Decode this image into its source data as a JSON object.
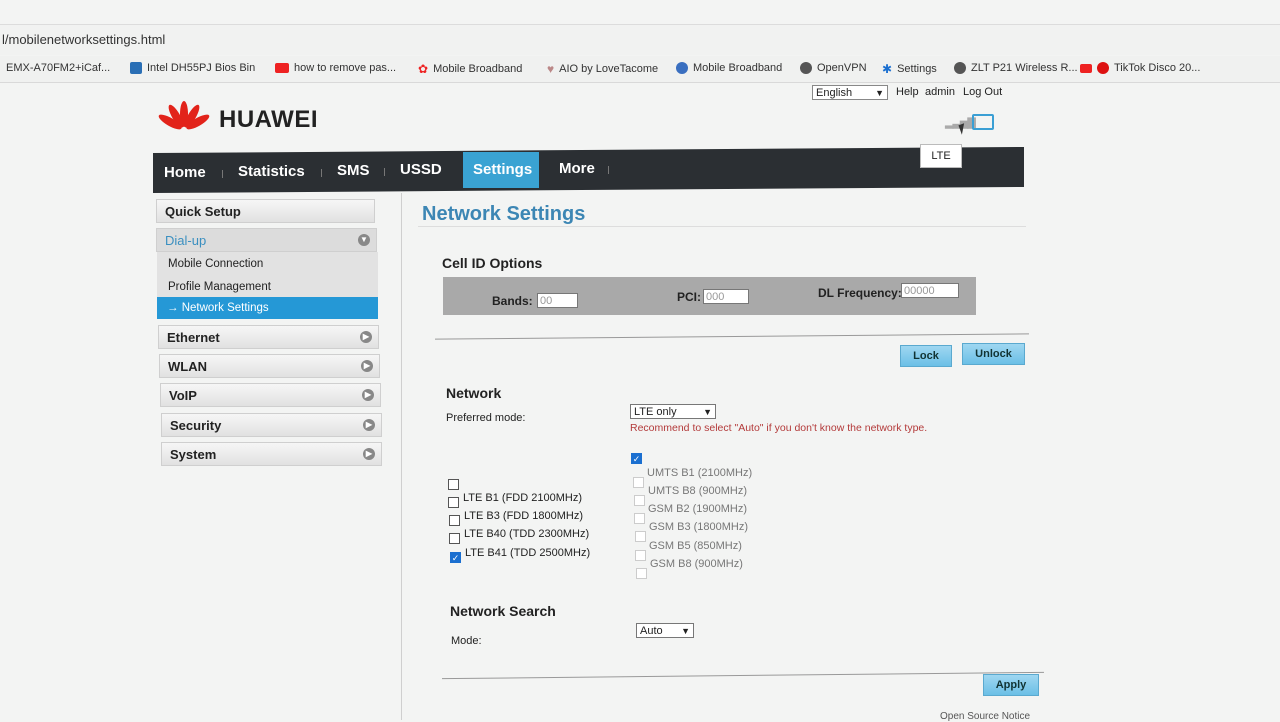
{
  "browser": {
    "url": "l/mobilenetworksettings.html",
    "bookmarks": [
      {
        "label": "EMX-A70FM2+iCaf...",
        "icon": "none"
      },
      {
        "label": "Intel DH55PJ Bios Bin",
        "icon": "page-icon"
      },
      {
        "label": "how to remove pas...",
        "icon": "youtube-icon"
      },
      {
        "label": "Mobile Broadband",
        "icon": "huawei-icon"
      },
      {
        "label": "AIO by LoveTacome",
        "icon": "heart-icon"
      },
      {
        "label": "Mobile Broadband",
        "icon": "globe-icon"
      },
      {
        "label": "OpenVPN",
        "icon": "globe-icon"
      },
      {
        "label": "Settings",
        "icon": "gear-icon"
      },
      {
        "label": "ZLT P21 Wireless R...",
        "icon": "globe-icon"
      },
      {
        "label": "TikTok Disco 20...",
        "icon": "youtube-icon"
      }
    ]
  },
  "header": {
    "brand": "HUAWEI",
    "language": "English",
    "links": [
      "Help",
      "admin",
      "Log Out"
    ],
    "status_tooltip": "LTE"
  },
  "nav": {
    "items": [
      "Home",
      "Statistics",
      "SMS",
      "USSD",
      "Settings",
      "More"
    ],
    "active": "Settings"
  },
  "sidebar": {
    "quick_setup": "Quick Setup",
    "dialup": "Dial-up",
    "dialup_items": [
      "Mobile Connection",
      "Profile Management",
      "Network Settings"
    ],
    "active_item": "Network Settings",
    "sections": [
      "Ethernet",
      "WLAN",
      "VoIP",
      "Security",
      "System"
    ]
  },
  "main": {
    "title": "Network Settings",
    "cell_id": {
      "heading": "Cell ID Options",
      "bands_label": "Bands:",
      "bands_placeholder": "00",
      "pci_label": "PCI:",
      "pci_placeholder": "000",
      "dl_label": "DL Frequency:",
      "dl_placeholder": "00000",
      "lock": "Lock",
      "unlock": "Unlock"
    },
    "network": {
      "heading": "Network",
      "preferred_label": "Preferred mode:",
      "preferred_value": "LTE only",
      "warning": "Recommend to select \"Auto\" if you don't know the network type.",
      "lte_bands": [
        {
          "label": "LTE B1 (FDD 2100MHz)",
          "checked": false
        },
        {
          "label": "LTE B3 (FDD 1800MHz)",
          "checked": false
        },
        {
          "label": "LTE B40 (TDD 2300MHz)",
          "checked": false
        },
        {
          "label": "LTE B41 (TDD 2500MHz)",
          "checked": true
        }
      ],
      "other_bands": [
        {
          "label": "UMTS B1 (2100MHz)",
          "checked": false
        },
        {
          "label": "UMTS B8 (900MHz)",
          "checked": false
        },
        {
          "label": "GSM B2 (1900MHz)",
          "checked": false
        },
        {
          "label": "GSM B3 (1800MHz)",
          "checked": false
        },
        {
          "label": "GSM B5 (850MHz)",
          "checked": false
        },
        {
          "label": "GSM B8 (900MHz)",
          "checked": false
        }
      ]
    },
    "search": {
      "heading": "Network Search",
      "mode_label": "Mode:",
      "mode_value": "Auto"
    },
    "apply": "Apply",
    "footer": "Open Source Notice"
  },
  "colors": {
    "accent": "#3aa3d3",
    "navbar": "#2b2f33",
    "title": "#3c86b4",
    "warning": "#b33a3a"
  }
}
